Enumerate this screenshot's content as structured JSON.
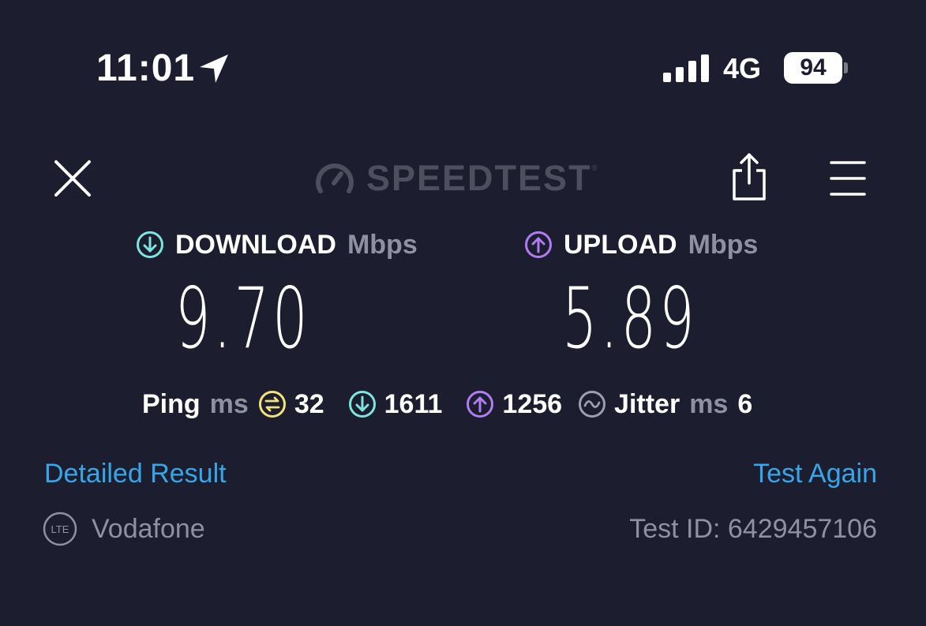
{
  "status_bar": {
    "time": "11:01",
    "network": "4G",
    "battery": "94",
    "icons": [
      "location-arrow-icon",
      "signal-bars-icon",
      "battery-icon"
    ]
  },
  "header": {
    "logo_text": "SPEEDTEST",
    "logo_tm": "®",
    "icons": [
      "close-icon",
      "speedometer-icon",
      "share-icon",
      "hamburger-menu-icon"
    ]
  },
  "download": {
    "label": "DOWNLOAD",
    "unit": "Mbps",
    "value": "9.70"
  },
  "upload": {
    "label": "UPLOAD",
    "unit": "Mbps",
    "value": "5.89"
  },
  "stats": {
    "ping_label": "Ping",
    "ping_unit": "ms",
    "ping_idle": "32",
    "ping_download": "1611",
    "ping_upload": "1256",
    "jitter_label": "Jitter",
    "jitter_unit": "ms",
    "jitter_value": "6"
  },
  "links": {
    "detailed_result": "Detailed Result",
    "test_again": "Test Again"
  },
  "footer": {
    "carrier_badge": "LTE",
    "carrier": "Vodafone",
    "test_id": "Test ID: 6429457106"
  },
  "colors": {
    "background": "#1c1d2f",
    "download_accent": "#7ee4e0",
    "upload_accent": "#b07cf2",
    "ping_accent": "#f2e27a",
    "link": "#35a7e8",
    "muted": "#8f91a3"
  }
}
